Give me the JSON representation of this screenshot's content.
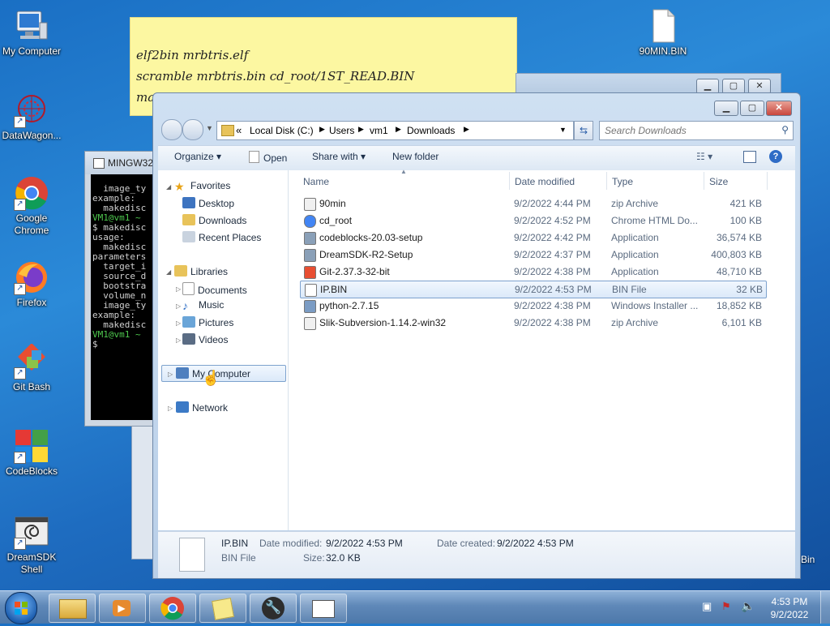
{
  "desktop_icons": {
    "my_computer": "My Computer",
    "datawagon": "DataWagon...",
    "chrome": "Google Chrome",
    "firefox": "Firefox",
    "gitbash": "Git Bash",
    "codeblocks": "CodeBlocks",
    "dreamsdk": "DreamSDK Shell",
    "ninetymin": "90MIN.BIN",
    "bin_partial": "Bin"
  },
  "sticky_note": {
    "lines": [
      "elf2bin mrbtris.elf",
      "scramble mrbtris.bin cd_root/1ST_READ.BIN",
      "ma"
    ]
  },
  "console": {
    "title": "MINGW32",
    "lines": [
      "  image_ty",
      "",
      "example:",
      "  makedisc",
      "",
      "VM1@vm1 ~",
      "$ makedisc",
      "usage:",
      "  makedisc",
      "",
      "parameters",
      "  target_i",
      "  source_d",
      "",
      "  bootstra",
      "  volume_n",
      "",
      "  image_ty",
      "",
      "example:",
      "  makedisc",
      "",
      "VM1@vm1 ~",
      "$"
    ]
  },
  "explorer": {
    "address": {
      "prefix": "«",
      "crumbs": [
        "Local Disk (C:)",
        "Users",
        "vm1",
        "Downloads"
      ]
    },
    "search_placeholder": "Search Downloads",
    "toolbar": {
      "organize": "Organize",
      "open": "Open",
      "share_with": "Share with",
      "new_folder": "New folder"
    },
    "nav": {
      "favorites": "Favorites",
      "desktop": "Desktop",
      "downloads": "Downloads",
      "recent_places": "Recent Places",
      "libraries": "Libraries",
      "documents": "Documents",
      "music": "Music",
      "pictures": "Pictures",
      "videos": "Videos",
      "my_computer": "My Computer",
      "network": "Network"
    },
    "columns": {
      "name": "Name",
      "date": "Date modified",
      "type": "Type",
      "size": "Size"
    },
    "files": [
      {
        "name": "90min",
        "date": "9/2/2022 4:44 PM",
        "type": "zip Archive",
        "size": "421 KB",
        "icon": "zip-icon"
      },
      {
        "name": "cd_root",
        "date": "9/2/2022 4:52 PM",
        "type": "Chrome HTML Do...",
        "size": "100 KB",
        "icon": "chrome-icon"
      },
      {
        "name": "codeblocks-20.03-setup",
        "date": "9/2/2022 4:42 PM",
        "type": "Application",
        "size": "36,574 KB",
        "icon": "setup-icon"
      },
      {
        "name": "DreamSDK-R2-Setup",
        "date": "9/2/2022 4:37 PM",
        "type": "Application",
        "size": "400,803 KB",
        "icon": "setup-icon"
      },
      {
        "name": "Git-2.37.3-32-bit",
        "date": "9/2/2022 4:38 PM",
        "type": "Application",
        "size": "48,710 KB",
        "icon": "git-icon"
      },
      {
        "name": "IP.BIN",
        "date": "9/2/2022 4:53 PM",
        "type": "BIN File",
        "size": "32 KB",
        "icon": "file-icon"
      },
      {
        "name": "python-2.7.15",
        "date": "9/2/2022 4:38 PM",
        "type": "Windows Installer ...",
        "size": "18,852 KB",
        "icon": "installer-icon"
      },
      {
        "name": "Slik-Subversion-1.14.2-win32",
        "date": "9/2/2022 4:38 PM",
        "type": "zip Archive",
        "size": "6,101 KB",
        "icon": "zip-icon"
      }
    ],
    "details": {
      "name": "IP.BIN",
      "type": "BIN File",
      "modified_label": "Date modified:",
      "modified": "9/2/2022 4:53 PM",
      "size_label": "Size:",
      "size": "32.0 KB",
      "created_label": "Date created:",
      "created": "9/2/2022 4:53 PM"
    }
  },
  "taskbar": {
    "time": "4:53 PM",
    "date": "9/2/2022"
  },
  "colors": {
    "accent": "#1a6fc4",
    "selection": "#dbe9f9",
    "close": "#c9463d"
  }
}
